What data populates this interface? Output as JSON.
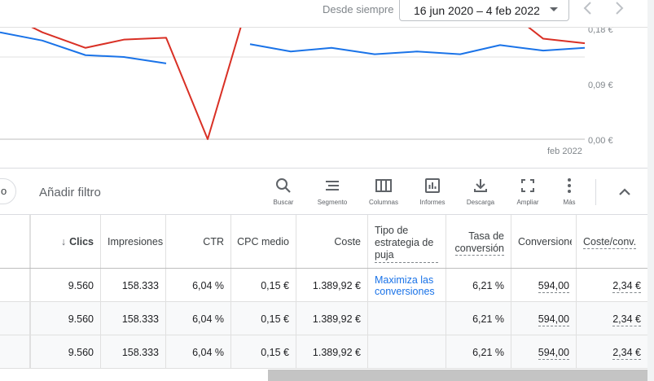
{
  "date_range": {
    "label": "Desde siempre",
    "value": "16 jun 2020 – 4 feb 2022"
  },
  "chart": {
    "y_ticks": [
      "0,18 €",
      "0,09 €",
      "0,00 €"
    ],
    "x_tick": "feb 2022",
    "colors": {
      "series_red": "#d93025",
      "series_blue": "#1a73e8"
    }
  },
  "chart_data": {
    "type": "line",
    "y_ticks": [
      "0,00 €",
      "0,09 €",
      "0,18 €"
    ],
    "ylim": [
      0,
      0.18
    ],
    "x_label": "feb 2022",
    "series": [
      {
        "color": "#d93025",
        "values": [
          0.14,
          0.117,
          0.1,
          0.109,
          0.111,
          0,
          0.157,
          0.145,
          0.147,
          0.13,
          0.139,
          0.135,
          0.147,
          0.11,
          0.105
        ]
      },
      {
        "color": "#1a73e8",
        "values": [
          0.117,
          0.108,
          0.092,
          0.09,
          0.083,
          null,
          0.104,
          0.096,
          0.1,
          0.093,
          0.096,
          0.093,
          0.103,
          0.097,
          0.1
        ]
      }
    ]
  },
  "toolbar": {
    "pill_text": "o",
    "add_filter": "Añadir filtro",
    "tools": [
      {
        "icon": "search-icon",
        "label": "Buscar"
      },
      {
        "icon": "segment-icon",
        "label": "Segmento"
      },
      {
        "icon": "columns-icon",
        "label": "Columnas"
      },
      {
        "icon": "reports-icon",
        "label": "Informes"
      },
      {
        "icon": "download-icon",
        "label": "Descarga"
      },
      {
        "icon": "expand-icon",
        "label": "Ampliar"
      },
      {
        "icon": "more-icon",
        "label": "Más"
      }
    ]
  },
  "table": {
    "headers": {
      "clicks": "Clics",
      "impressions": "Impresiones",
      "ctr": "CTR",
      "cpc": "CPC medio",
      "cost": "Coste",
      "bid_strategy_1": "Tipo de",
      "bid_strategy_2": "estrategia de",
      "bid_strategy_3": "puja",
      "conv_rate_1": "Tasa de",
      "conv_rate_2": "conversión",
      "conversions": "Conversione",
      "cost_conv": "Coste/conv."
    },
    "rows": [
      {
        "clicks": "9.560",
        "impressions": "158.333",
        "ctr": "6,04 %",
        "cpc": "0,15 €",
        "cost": "1.389,92 €",
        "strategy_1": "Maximiza las",
        "strategy_2": "conversiones",
        "conv_rate": "6,21 %",
        "conversions": "594,00",
        "cost_conv": "2,34 €"
      },
      {
        "clicks": "9.560",
        "impressions": "158.333",
        "ctr": "6,04 %",
        "cpc": "0,15 €",
        "cost": "1.389,92 €",
        "strategy_1": "",
        "strategy_2": "",
        "conv_rate": "6,21 %",
        "conversions": "594,00",
        "cost_conv": "2,34 €"
      },
      {
        "clicks": "9.560",
        "impressions": "158.333",
        "ctr": "6,04 %",
        "cpc": "0,15 €",
        "cost": "1.389,92 €",
        "strategy_1": "",
        "strategy_2": "",
        "conv_rate": "6,21 %",
        "conversions": "594,00",
        "cost_conv": "2,34 €"
      }
    ]
  }
}
